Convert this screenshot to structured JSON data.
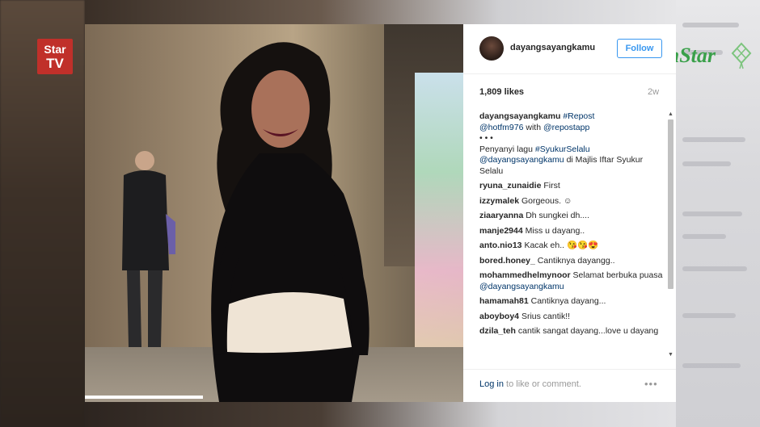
{
  "overlay": {
    "channel_logo_line1": "Star",
    "channel_logo_line2": "TV",
    "brand_logo": "mStar"
  },
  "post": {
    "username": "dayangsayangkamu",
    "follow_label": "Follow",
    "likes": "1,809 likes",
    "age": "2w",
    "caption": {
      "username": "dayangsayangkamu",
      "text1": "#Repost",
      "text2": "@hotfm976",
      "text3": " with ",
      "text4": "@repostapp",
      "dots": "• • •",
      "line_a": "Penyanyi lagu ",
      "tag": "#SyukurSelalu",
      "mention": "@dayangsayangkamu",
      "line_b": " di Majlis Iftar Syukur Selalu"
    },
    "comments": [
      {
        "user": "ryuna_zunaidie",
        "text": "First"
      },
      {
        "user": "izzymalek",
        "text": "Gorgeous. ☺"
      },
      {
        "user": "ziaaryanna",
        "text": "Dh sungkei dh...."
      },
      {
        "user": "manje2944",
        "text": "Miss u dayang.."
      },
      {
        "user": "anto.nio13",
        "text": "Kacak eh.. 😘😘😍"
      },
      {
        "user": "bored.honey_",
        "text": "Cantiknya dayangg.."
      },
      {
        "user": "mohammedhelmynoor",
        "text": "Selamat berbuka puasa",
        "mention": "@dayangsayangkamu"
      },
      {
        "user": "hamamah81",
        "text": "Cantiknya dayang..."
      },
      {
        "user": "aboyboy4",
        "text": "Srius cantik!!"
      },
      {
        "user": "dzila_teh",
        "text": "cantik sangat dayang...love u dayang"
      }
    ],
    "login_link": "Log in",
    "login_text": " to like or comment.",
    "more_label": "•••"
  },
  "colors": {
    "accent": "#3897f0",
    "link": "#003569",
    "startv_red": "#c0302a",
    "mstar_green": "#3aa04a"
  },
  "icons": {
    "options": "more-options-icon",
    "scroll_up": "scroll-up-arrow-icon",
    "scroll_down": "scroll-down-arrow-icon"
  }
}
